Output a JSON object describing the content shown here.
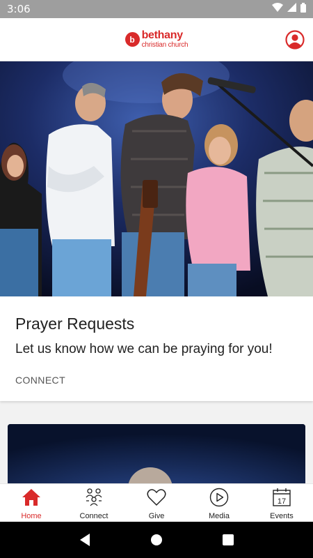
{
  "status_bar": {
    "time": "3:06",
    "icons": [
      "wifi-icon",
      "cellular-icon",
      "battery-icon"
    ]
  },
  "header": {
    "logo_badge": "b",
    "logo_line1": "bethany",
    "logo_line2": "christian church",
    "profile_icon": "profile-icon"
  },
  "colors": {
    "brand": "#d92a2a",
    "status_bar": "#9e9e9e",
    "system_nav": "#000000"
  },
  "feed": [
    {
      "title": "Prayer Requests",
      "subtitle": "Let us know how we can be praying for you!",
      "category": "CONNECT"
    }
  ],
  "bottom_nav": {
    "items": [
      {
        "label": "Home",
        "icon": "home-icon",
        "active": true
      },
      {
        "label": "Connect",
        "icon": "people-icon",
        "active": false
      },
      {
        "label": "Give",
        "icon": "heart-icon",
        "active": false
      },
      {
        "label": "Media",
        "icon": "play-icon",
        "active": false
      },
      {
        "label": "Events",
        "icon": "calendar-icon",
        "active": false,
        "badge_text": "17"
      }
    ]
  },
  "system_nav": [
    "back-icon",
    "home-circle-icon",
    "recents-icon"
  ]
}
